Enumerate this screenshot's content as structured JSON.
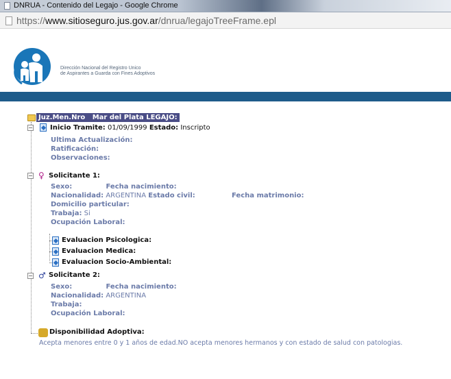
{
  "window": {
    "title": "DNRUA - Contenido del Legajo - Google Chrome"
  },
  "address": {
    "scheme": "https://",
    "domain": "www.sitioseguro.jus.gov.ar",
    "path": "/dnrua/legajoTreeFrame.epl"
  },
  "header": {
    "org_line1": "Dirección Nacional del Registro Unico",
    "org_line2": "de Aspirantes a Guarda con Fines Adoptivos"
  },
  "tree": {
    "root": {
      "prefix": "Juz.Men.Nro",
      "location": "Mar del Plata LEGAJO:"
    },
    "tramite": {
      "inicio_label": "Inicio Tramite:",
      "inicio_value": "01/09/1999",
      "estado_label": "Estado:",
      "estado_value": "Inscripto",
      "ultima_label": "Ultima Actualización:",
      "ratificacion_label": "Ratificación:",
      "observaciones_label": "Observaciones:"
    },
    "solicitante1": {
      "title": "Solicitante 1:",
      "sexo_label": "Sexo:",
      "fecha_nac_label": "Fecha nacimiento:",
      "nacionalidad_label": "Nacionalidad:",
      "nacionalidad_value": "ARGENTINA",
      "estado_civil_label": "Estado civil:",
      "fecha_matrimonio_label": "Fecha matrimonio:",
      "domicilio_label": "Domicilio particular:",
      "trabaja_label": "Trabaja:",
      "trabaja_value": "Si",
      "ocupacion_label": "Ocupación Laboral:",
      "evaluaciones": [
        "Evaluacion Psicologica:",
        "Evaluacion Medica:",
        "Evaluacion Socio-Ambiental:"
      ]
    },
    "solicitante2": {
      "title": "Solicitante 2:",
      "sexo_label": "Sexo:",
      "fecha_nac_label": "Fecha nacimiento:",
      "nacionalidad_label": "Nacionalidad:",
      "nacionalidad_value": "ARGENTINA",
      "trabaja_label": "Trabaja:",
      "ocupacion_label": "Ocupación Laboral:"
    },
    "disponibilidad": {
      "title": "Disponibilidad Adoptiva:",
      "text": "Acepta menores entre 0 y 1 años de edad.NO acepta menores hermanos y con estado de salud con patologias."
    }
  },
  "colors": {
    "brand_bar": "#1e5b8a",
    "root_highlight": "#4a4d86",
    "label_blue": "#6a7aa8"
  }
}
